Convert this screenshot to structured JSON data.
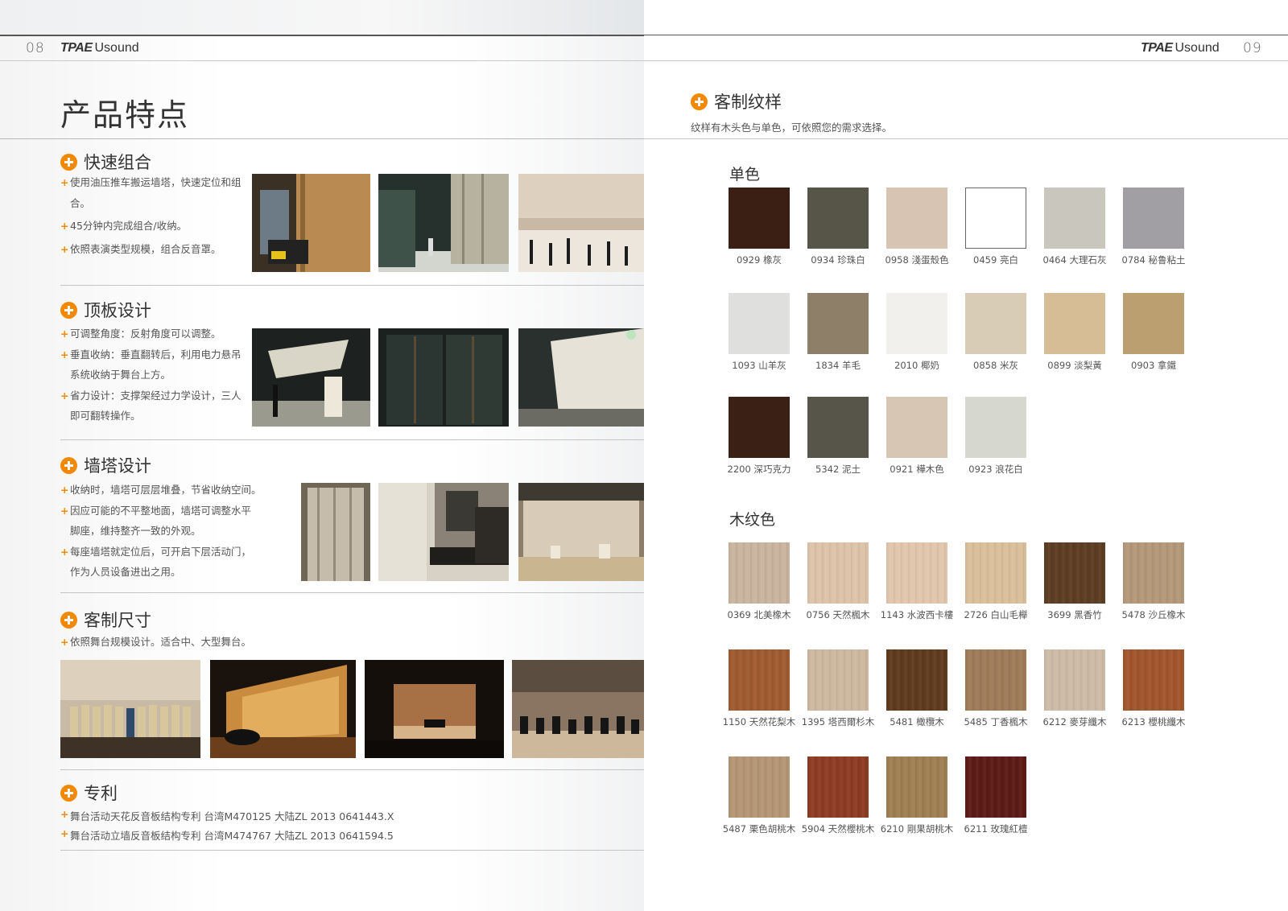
{
  "header": {
    "left_page_number": "08",
    "right_page_number": "09",
    "brand_bold": "TPAE",
    "brand_light": "Usound"
  },
  "left": {
    "title": "产品特点",
    "sections": [
      {
        "title": "快速组合",
        "bullets": [
          [
            "使用油压推车搬运墙塔，快速定位和组合。"
          ],
          [
            "45分钟内完成组合/收纳。"
          ],
          [
            "依照表演类型规模，组合反音罩。"
          ]
        ]
      },
      {
        "title": "顶板设计",
        "bullets": [
          [
            "可调整角度：反射角度可以调整。"
          ],
          [
            "垂直收纳：垂直翻转后，利用电力悬吊",
            "系统收纳于舞台上方。"
          ],
          [
            "省力设计：支撑架经过力学设计，三人",
            "即可翻转操作。"
          ]
        ]
      },
      {
        "title": "墙塔设计",
        "bullets": [
          [
            "收纳时，墙塔可层层堆叠，节省收纳空间。"
          ],
          [
            "因应可能的不平整地面，墙塔可调整水平",
            "脚座，维持整齐一致的外观。"
          ],
          [
            "每座墙塔就定位后，可开启下层活动门，",
            "作为人员设备进出之用。"
          ]
        ]
      },
      {
        "title": "客制尺寸",
        "bullets": [
          [
            "依照舞台规模设计。适合中、大型舞台。"
          ]
        ]
      },
      {
        "title": "专利",
        "bullets": [
          [
            "舞台活动天花反音板结构专利 台湾M470125 大陆ZL 2013 0641443.X"
          ],
          [
            "舞台活动立墙反音板结构专利 台湾M474767 大陆ZL 2013 0641594.5"
          ]
        ]
      }
    ]
  },
  "right": {
    "title": "客制纹样",
    "description": "纹样有木头色与单色，可依照您的需求选择。",
    "solid_title": "单色",
    "wood_title": "木纹色",
    "solid": [
      {
        "label": "0929 橡灰",
        "color": "#3c1f14"
      },
      {
        "label": "0934 珍珠白",
        "color": "#575548"
      },
      {
        "label": "0958 淺蛋殼色",
        "color": "#d8c4b2"
      },
      {
        "label": "0459 亮白",
        "color": "#ffffff"
      },
      {
        "label": "0464 大理石灰",
        "color": "#c9c6bd"
      },
      {
        "label": "0784 秘鲁粘土",
        "color": "#a29fa4"
      },
      {
        "label": "1093 山羊灰",
        "color": "#dfe0de"
      },
      {
        "label": "1834 羊毛",
        "color": "#8e7f69"
      },
      {
        "label": "2010 椰奶",
        "color": "#f1f0ec"
      },
      {
        "label": "0858 米灰",
        "color": "#d8ccb6"
      },
      {
        "label": "0899 淡梨黃",
        "color": "#d6bd96"
      },
      {
        "label": "0903 拿鐵",
        "color": "#bb9f70"
      },
      {
        "label": "2200 深巧克力",
        "color": "#3a2015"
      },
      {
        "label": "5342 泥土",
        "color": "#575549"
      },
      {
        "label": "0921 樺木色",
        "color": "#d8c6b4"
      },
      {
        "label": "0923 浪花白",
        "color": "#d6d8d0"
      }
    ],
    "wood": [
      {
        "label": "0369 北美橡木",
        "color": "#c9b39d"
      },
      {
        "label": "0756 天然楓木",
        "color": "#dcc3a8"
      },
      {
        "label": "1143 水波西卡樓",
        "color": "#e0c6ab"
      },
      {
        "label": "2726 白山毛櫸",
        "color": "#d9bf9b"
      },
      {
        "label": "3699 黑香竹",
        "color": "#5c3d22"
      },
      {
        "label": "5478 沙丘橡木",
        "color": "#b49779"
      },
      {
        "label": "1150 天然花梨木",
        "color": "#9f5a2f"
      },
      {
        "label": "1395 塔西爾杉木",
        "color": "#cdb89f"
      },
      {
        "label": "5481 橄欖木",
        "color": "#5f3a1d"
      },
      {
        "label": "5485 丁香楓木",
        "color": "#9d7a58"
      },
      {
        "label": "6212 麥芽纖木",
        "color": "#cdbba7"
      },
      {
        "label": "6213 櫻桃纖木",
        "color": "#a2552c"
      },
      {
        "label": "5487 栗色胡桃木",
        "color": "#b39674"
      },
      {
        "label": "5904 天然櫻桃木",
        "color": "#8d3a22"
      },
      {
        "label": "6210 剛果胡桃木",
        "color": "#9f7e52"
      },
      {
        "label": "6211 玫瑰紅檀",
        "color": "#5c1a16"
      }
    ]
  }
}
